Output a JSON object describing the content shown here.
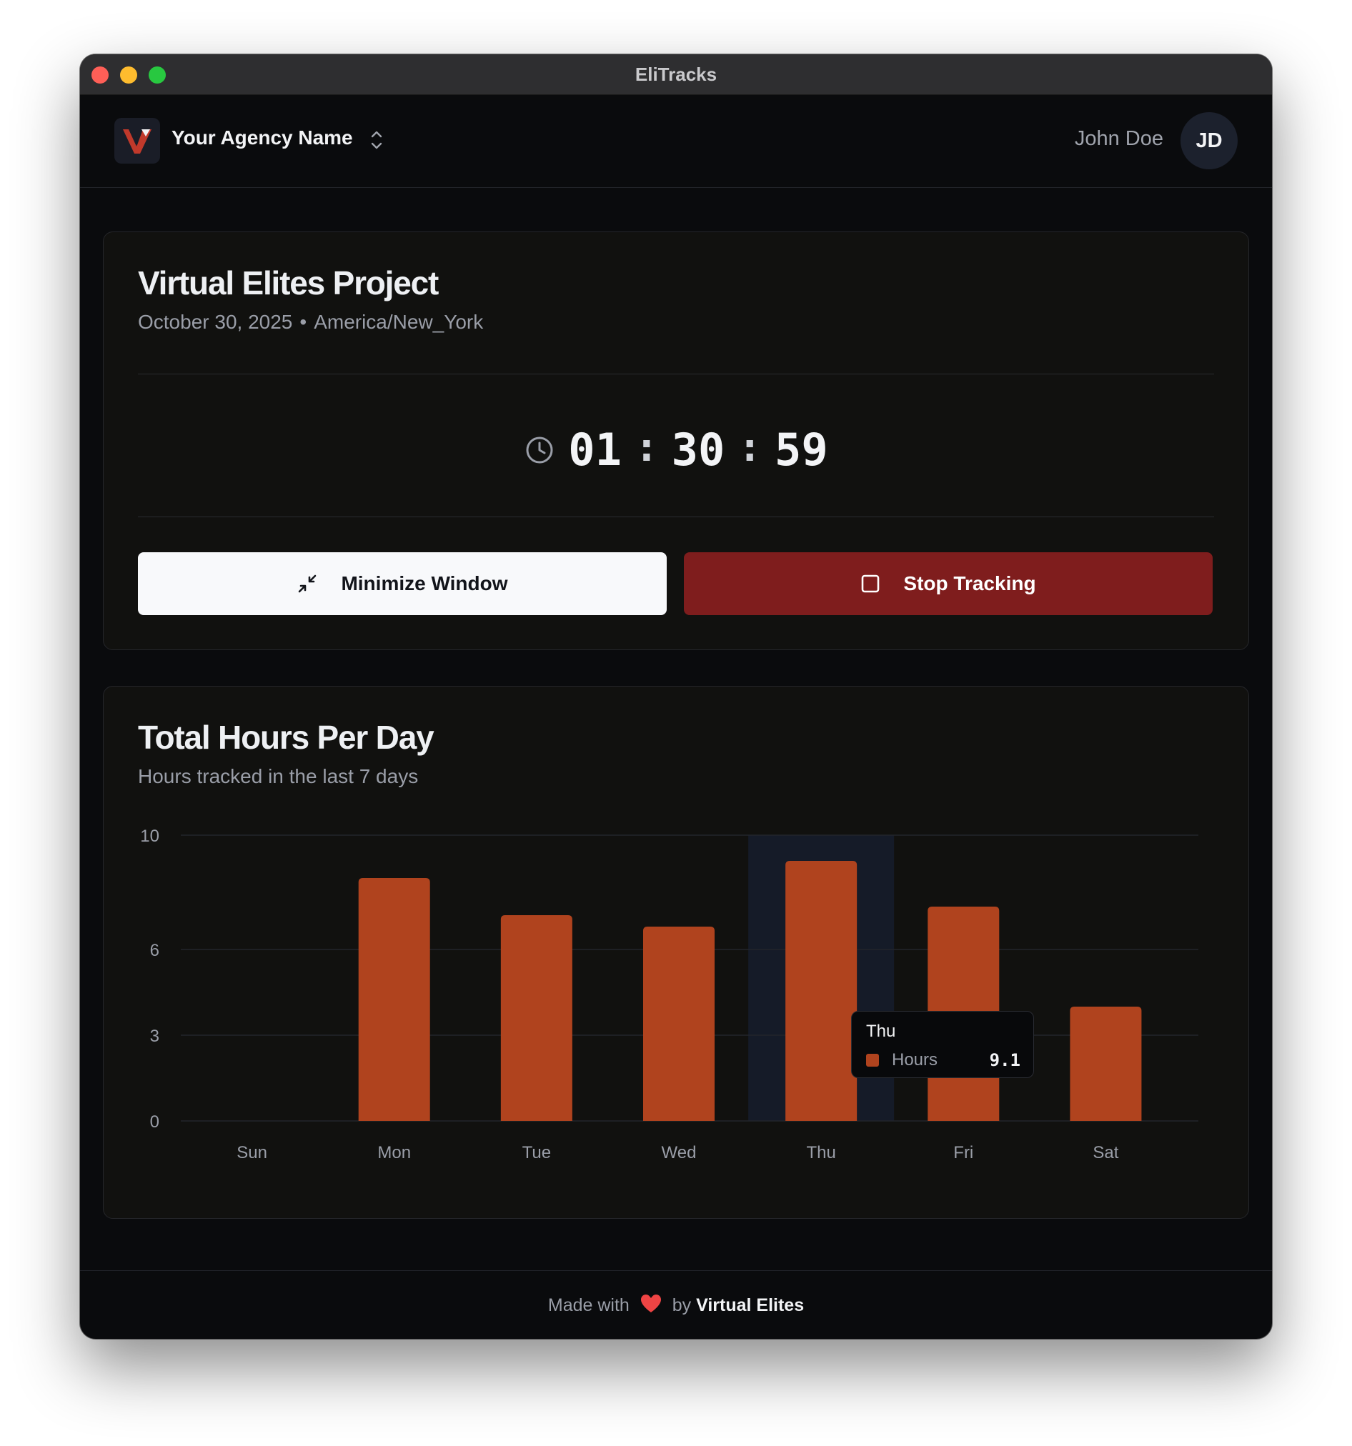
{
  "window": {
    "title": "EliTracks"
  },
  "header": {
    "agency_name": "Your Agency Name",
    "user_name": "John Doe",
    "user_initials": "JD"
  },
  "project": {
    "title": "Virtual Elites Project",
    "date": "October 30, 2025",
    "separator": "•",
    "timezone": "America/New_York",
    "timer": {
      "hours": "01",
      "minutes": "30",
      "seconds": "59"
    },
    "minimize_label": "Minimize Window",
    "stop_label": "Stop Tracking"
  },
  "chart_card": {
    "title": "Total Hours Per Day",
    "subtitle": "Hours tracked in the last 7 days"
  },
  "chart_data": {
    "type": "bar",
    "categories": [
      "Sun",
      "Mon",
      "Tue",
      "Wed",
      "Thu",
      "Fri",
      "Sat"
    ],
    "series": [
      {
        "name": "Hours",
        "values": [
          0,
          8.5,
          7.2,
          6.8,
          9.1,
          7.5,
          4.0
        ]
      }
    ],
    "ylim": [
      0,
      10
    ],
    "yticks": [
      0,
      3,
      6,
      10
    ],
    "grid": true,
    "highlighted_category": "Thu",
    "colors": {
      "bar": "#b0431e",
      "highlight": "#151b28",
      "grid": "#23252b"
    },
    "tooltip": {
      "category": "Thu",
      "label": "Hours",
      "value": "9.1"
    }
  },
  "footer": {
    "prefix": "Made with",
    "by": "by",
    "brand": "Virtual Elites"
  }
}
